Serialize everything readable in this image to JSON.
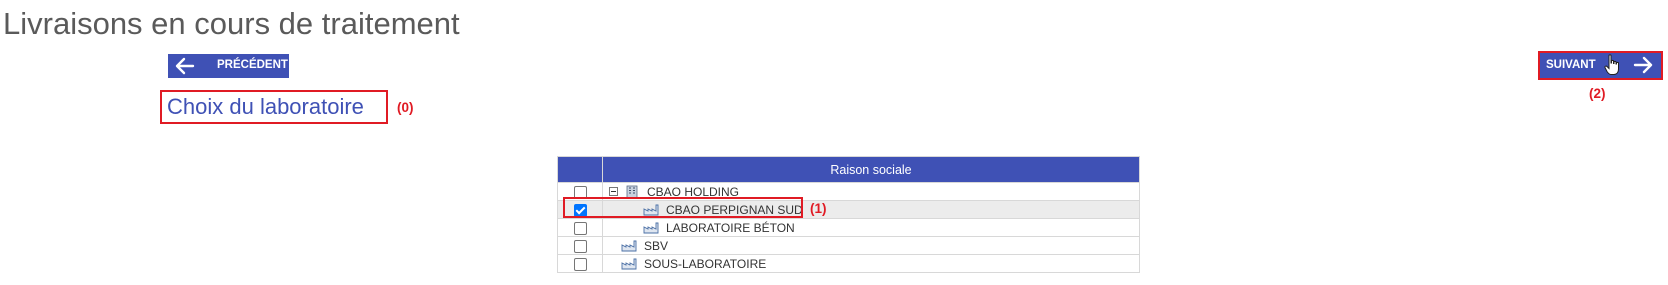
{
  "page": {
    "title": "Livraisons en cours de traitement"
  },
  "nav": {
    "prev_label": "PRÉCÉDENT",
    "next_label": "SUIVANT"
  },
  "step": {
    "heading": "Choix du laboratoire"
  },
  "annotations": {
    "heading": "(0)",
    "selected_row": "(1)",
    "next_button": "(2)"
  },
  "table": {
    "header": "Raison sociale",
    "rows": [
      {
        "label": "CBAO HOLDING",
        "checked": false,
        "level": 0,
        "icon": "building-icon",
        "expander": "collapse-icon"
      },
      {
        "label": "CBAO PERPIGNAN SUD",
        "checked": true,
        "level": 2,
        "icon": "factory-icon"
      },
      {
        "label": "LABORATOIRE BÉTON",
        "checked": false,
        "level": 2,
        "icon": "factory-icon"
      },
      {
        "label": "SBV",
        "checked": false,
        "level": 1,
        "icon": "factory-icon"
      },
      {
        "label": "SOUS-LABORATOIRE",
        "checked": false,
        "level": 1,
        "icon": "factory-icon"
      }
    ]
  },
  "colors": {
    "primary": "#3f51b5",
    "annotation": "#e01b24",
    "title": "#5a5a5a"
  }
}
